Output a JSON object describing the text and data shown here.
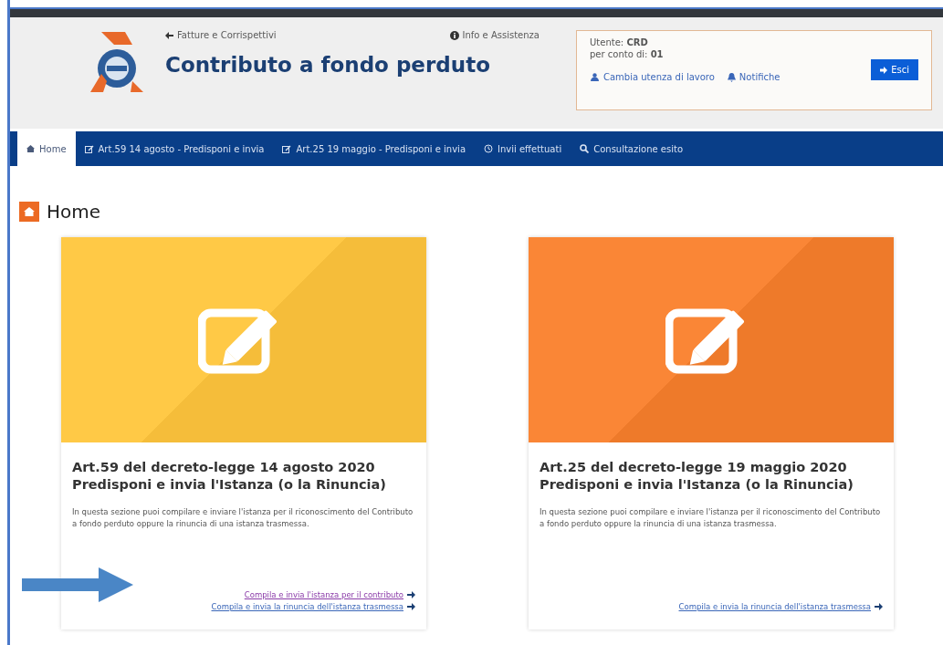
{
  "header": {
    "back_link": "Fatture e Corrispettivi",
    "title": "Contributo a fondo perduto",
    "help_link": "Info e Assistenza",
    "user_box": {
      "user_label": "Utente:",
      "user": "CRD",
      "account_label": "per conto di:",
      "account": "01",
      "change_link": "Cambia utenza di lavoro",
      "notifications_link": "Notifiche",
      "exit_button": "Esci"
    }
  },
  "nav": [
    {
      "kind": "home",
      "label": "Home",
      "selected": true
    },
    {
      "kind": "edit",
      "label": "Art.59 14 agosto - Predisponi e invia",
      "selected": false
    },
    {
      "kind": "edit",
      "label": "Art.25 19 maggio - Predisponi e invia",
      "selected": false
    },
    {
      "kind": "sent",
      "label": "Invii effettuati",
      "selected": false
    },
    {
      "kind": "search",
      "label": "Consultazione esito",
      "selected": false
    }
  ],
  "page_title": "Home",
  "cards": [
    {
      "color": "#f5bd3a",
      "title_line_1": "Art.59 del decreto-legge 14 agosto 2020",
      "title_line_2": "Predisponi e invia l'Istanza (o la Rinuncia)",
      "text": "In questa sezione puoi compilare e inviare l'istanza per il riconoscimento del Contributo a fondo perduto oppure la rinuncia di una istanza trasmessa.",
      "annotated": true,
      "links": [
        {
          "label": "Compila e invia l'istanza per il contributo",
          "visited": true
        },
        {
          "label": "Compila e invia la rinuncia dell'istanza trasmessa",
          "visited": false
        }
      ]
    },
    {
      "color": "#ee7a2a",
      "title_line_1": "Art.25 del decreto-legge 19 maggio 2020",
      "title_line_2": "Predisponi e invia l'Istanza (o la Rinuncia)",
      "text": "In questa sezione puoi compilare e inviare l'istanza per il riconoscimento del Contributo a fondo perduto oppure la rinuncia di una istanza trasmessa.",
      "annotated": false,
      "links": [
        {
          "label": "Compila e invia la rinuncia dell'istanza trasmessa",
          "visited": false
        }
      ]
    }
  ]
}
